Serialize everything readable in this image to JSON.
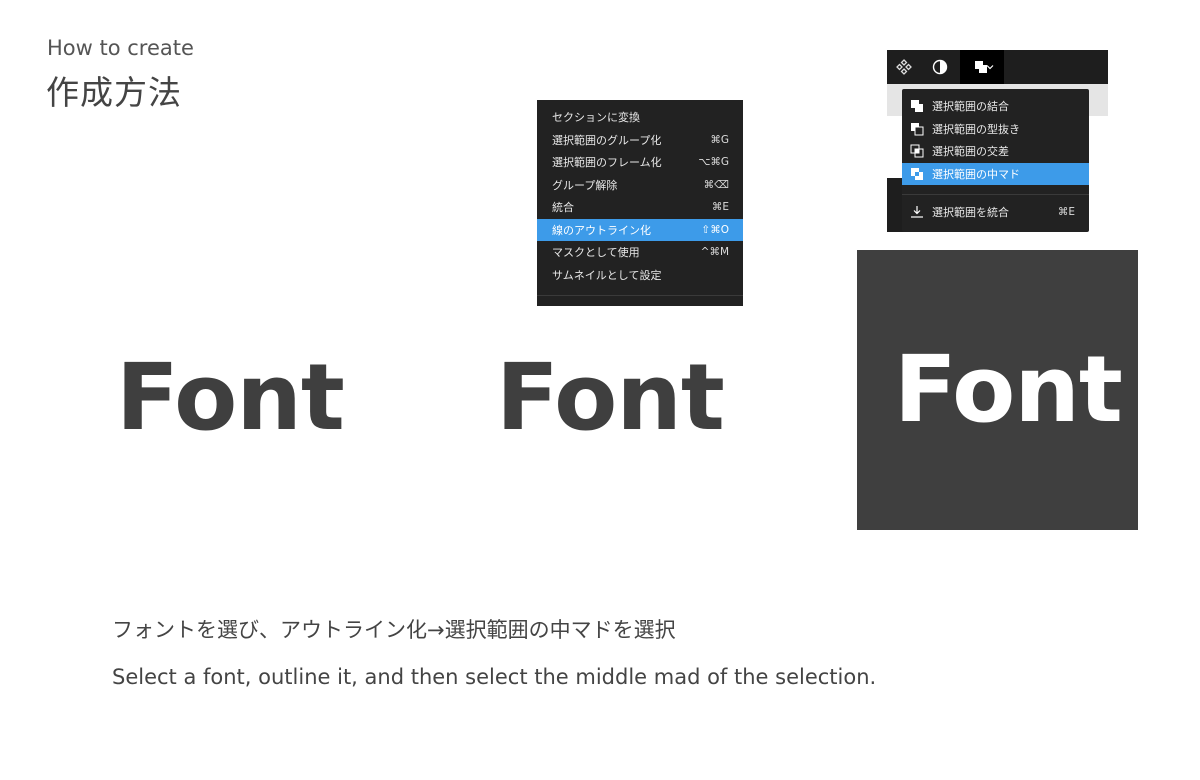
{
  "header": {
    "subtitle": "How to create",
    "title": "作成方法"
  },
  "context_menu": {
    "items": [
      {
        "label": "セクションに変換",
        "shortcut": ""
      },
      {
        "label": "選択範囲のグループ化",
        "shortcut": "⌘G"
      },
      {
        "label": "選択範囲のフレーム化",
        "shortcut": "⌥⌘G"
      },
      {
        "label": "グループ解除",
        "shortcut": "⌘⌫"
      },
      {
        "label": "統合",
        "shortcut": "⌘E"
      },
      {
        "label": "線のアウトライン化",
        "shortcut": "⇧⌘O"
      },
      {
        "label": "マスクとして使用",
        "shortcut": "^⌘M"
      },
      {
        "label": "サムネイルとして設定",
        "shortcut": ""
      }
    ],
    "highlighted_index": 5
  },
  "toolbar": {
    "icons": [
      "component-icon",
      "contrast-icon",
      "boolean-union-icon",
      "chevron-down-icon"
    ]
  },
  "boolean_menu": {
    "items": [
      {
        "label": "選択範囲の結合",
        "icon": "union-icon"
      },
      {
        "label": "選択範囲の型抜き",
        "icon": "subtract-icon"
      },
      {
        "label": "選択範囲の交差",
        "icon": "intersect-icon"
      },
      {
        "label": "選択範囲の中マド",
        "icon": "exclude-icon"
      }
    ],
    "highlighted_index": 3,
    "flatten": {
      "label": "選択範囲を統合",
      "shortcut": "⌘E",
      "icon": "flatten-icon"
    }
  },
  "samples": {
    "text_1": "Font",
    "text_2": "Font",
    "text_3": "Font"
  },
  "caption": {
    "ja": "フォントを選び、アウトライン化→選択範囲の中マドを選択",
    "en": "Select a font, outline it, and then select the middle mad of the selection."
  },
  "colors": {
    "menu_bg": "#222222",
    "highlight": "#3d9be9",
    "panel_bg": "#3f3f3f",
    "text": "#444444"
  }
}
